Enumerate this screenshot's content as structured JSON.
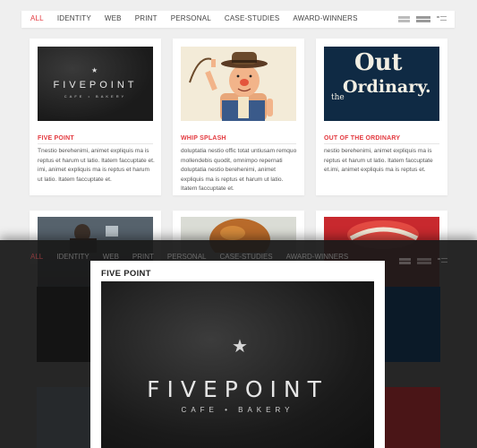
{
  "filters": [
    "ALL",
    "IDENTITY",
    "WEB",
    "PRINT",
    "PERSONAL",
    "CASE-STUDIES",
    "AWARD-WINNERS"
  ],
  "active_filter": "ALL",
  "view_icons": [
    "small-grid-icon",
    "large-grid-icon",
    "list-icon"
  ],
  "cards": [
    {
      "title": "FIVE POINT",
      "desc": "Tnestio berehenimi, animet expliquis ma is reptus et harum ut latio. Itatem faccuptate et. imi, animet expliquis ma is reptus et harum ut latio. Itatem faccuptate et."
    },
    {
      "title": "WHIP SPLASH",
      "desc": "doluptatia nestio offic totat untiusam remquo mollendebis quodit, omnimpo repernati doluptatia nestio berehenimi, animet expliquis ma is reptus et harum ut latio. Itatem faccuptate et."
    },
    {
      "title": "OUT OF THE ORDINARY",
      "desc": "nestio berehenimi, animet expliquis ma is reptus et harum ut latio. Itatem faccuptate et.imi, animet expliquis ma is reptus et."
    }
  ],
  "thumb_text": {
    "fivepoint_logo": "FIVEPOINT",
    "fivepoint_sub": "CAFE • BAKERY",
    "ordinary_1": "Out",
    "ordinary_2": "Ordinary.",
    "ordinary_3": "the"
  },
  "modal": {
    "title": "FIVE POINT",
    "logo": "FIVEPOINT",
    "sub": "CAFE • BAKERY"
  },
  "colors": {
    "accent": "#e3393f",
    "overlay": "#191919"
  }
}
